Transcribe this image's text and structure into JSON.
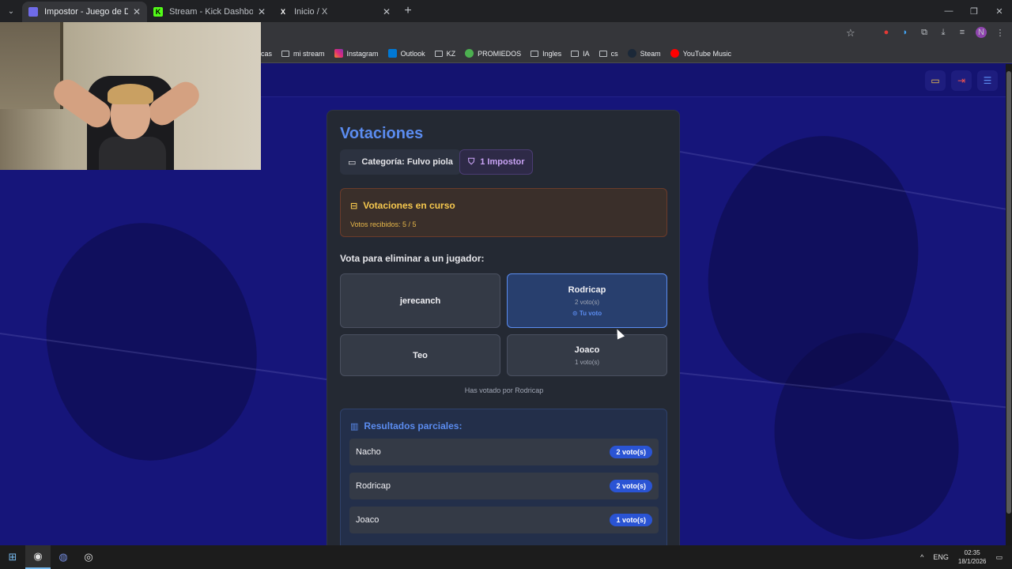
{
  "browser": {
    "tabs": [
      {
        "label": "Impostor - Juego de Deducción",
        "favicon_color": "#6f6be8",
        "active": true
      },
      {
        "label": "Stream - Kick Dashboard",
        "favicon_color": "#53fc18",
        "active": false
      },
      {
        "label": "Inicio / X",
        "favicon_color": "#ffffff",
        "active": false
      }
    ],
    "bookmarks": [
      {
        "label": "cas",
        "icon": "truncated"
      },
      {
        "label": "mi stream",
        "icon": "folder-icon"
      },
      {
        "label": "Instagram",
        "icon": "instagram-icon"
      },
      {
        "label": "Outlook",
        "icon": "outlook-icon"
      },
      {
        "label": "KZ",
        "icon": "folder-icon"
      },
      {
        "label": "PROMIEDOS",
        "icon": "promiedos-icon"
      },
      {
        "label": "Ingles",
        "icon": "folder-icon"
      },
      {
        "label": "IA",
        "icon": "folder-icon"
      },
      {
        "label": "cs",
        "icon": "folder-icon"
      },
      {
        "label": "Steam",
        "icon": "steam-icon"
      },
      {
        "label": "YouTube Music",
        "icon": "youtube-music-icon"
      }
    ],
    "profile_initial": "N"
  },
  "game": {
    "title": "Votaciones",
    "category_chip": "Categoría: Fulvo piola",
    "impostor_chip": "1 Impostor",
    "alert": {
      "title": "Votaciones en curso",
      "subtitle": "Votos recibidos: 5 / 5"
    },
    "vote_prompt": "Vota para eliminar a un jugador:",
    "players": [
      {
        "name": "jerecanch",
        "votes": "",
        "mine": ""
      },
      {
        "name": "Rodricap",
        "votes": "2 voto(s)",
        "mine": "Tu voto"
      },
      {
        "name": "Teo",
        "votes": "",
        "mine": ""
      },
      {
        "name": "Joaco",
        "votes": "1 voto(s)",
        "mine": ""
      }
    ],
    "voted_for": "Has votado por Rodricap",
    "results": {
      "title": "Resultados parciales:",
      "rows": [
        {
          "name": "Nacho",
          "votes": "2 voto(s)"
        },
        {
          "name": "Rodricap",
          "votes": "2 voto(s)"
        },
        {
          "name": "Joaco",
          "votes": "1 voto(s)"
        }
      ]
    }
  },
  "taskbar": {
    "lang": "ENG",
    "time": "02:35",
    "date": "18/1/2026"
  },
  "colors": {
    "accent_blue": "#5b8cf0",
    "alert_yellow": "#f6c84e",
    "background": "#16157a",
    "card": "#242933"
  }
}
